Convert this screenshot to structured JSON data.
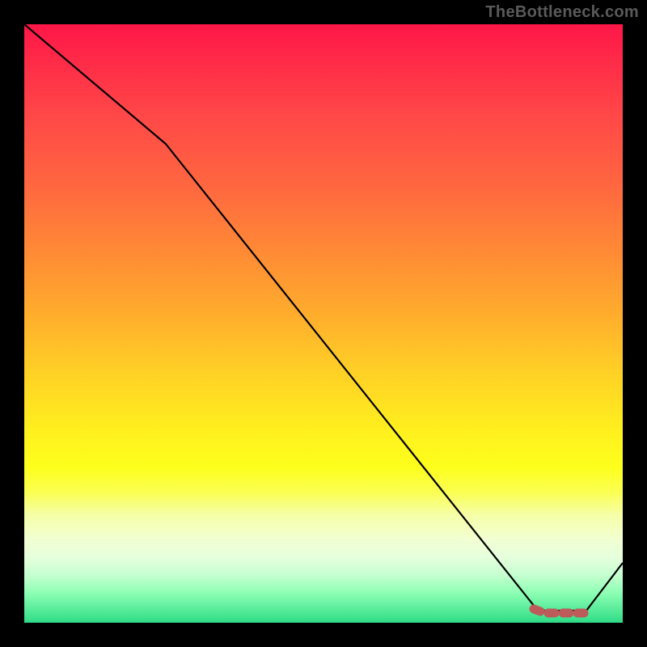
{
  "watermark": "TheBottleneck.com",
  "chart_data": {
    "type": "line",
    "title": "",
    "xlabel": "",
    "ylabel": "",
    "xlim": [
      0,
      100
    ],
    "ylim": [
      0,
      100
    ],
    "background_gradient_stops": [
      {
        "pos": 0,
        "color": "#ff1648"
      },
      {
        "pos": 15,
        "color": "#ff4748"
      },
      {
        "pos": 38,
        "color": "#ff8a35"
      },
      {
        "pos": 58,
        "color": "#ffd026"
      },
      {
        "pos": 74,
        "color": "#fdff1c"
      },
      {
        "pos": 86,
        "color": "#f2ffd1"
      },
      {
        "pos": 95,
        "color": "#8dffb4"
      },
      {
        "pos": 100,
        "color": "#2fd985"
      }
    ],
    "series": [
      {
        "name": "main-curve",
        "color": "#000000",
        "stroke_width": 2,
        "x": [
          0,
          24,
          86,
          94,
          100
        ],
        "y": [
          100,
          80,
          2,
          2,
          10
        ]
      },
      {
        "name": "highlight-segment",
        "color": "#c05a5a",
        "stroke_width": 8,
        "dashed": true,
        "x": [
          85,
          94
        ],
        "y": [
          2,
          2
        ]
      }
    ]
  }
}
